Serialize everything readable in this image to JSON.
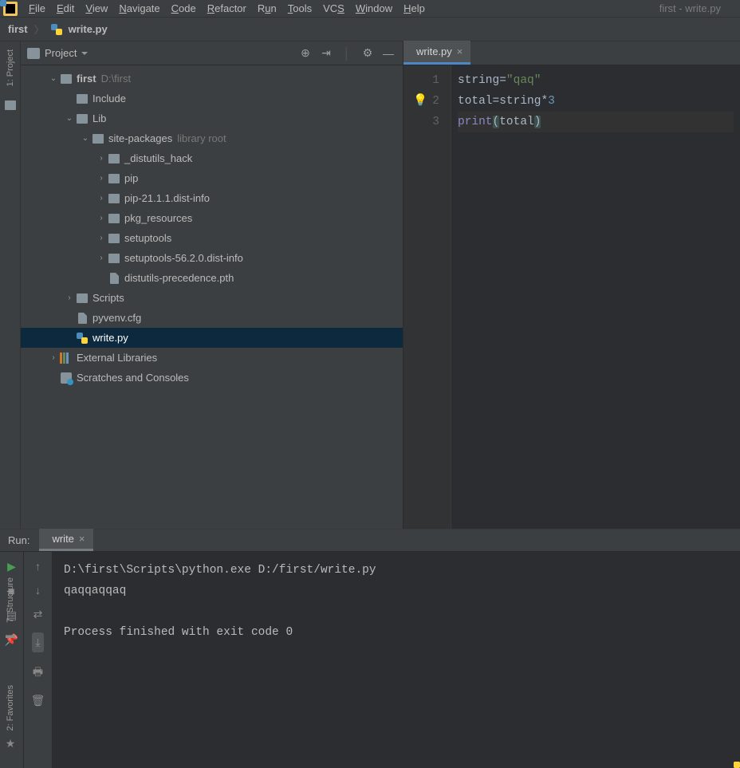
{
  "menubar": {
    "items": [
      {
        "label": "File",
        "u": "F",
        "rest": "ile"
      },
      {
        "label": "Edit",
        "u": "E",
        "rest": "dit"
      },
      {
        "label": "View",
        "u": "V",
        "rest": "iew"
      },
      {
        "label": "Navigate",
        "u": "N",
        "rest": "avigate"
      },
      {
        "label": "Code",
        "u": "C",
        "rest": "ode"
      },
      {
        "label": "Refactor",
        "u": "R",
        "rest": "efactor"
      },
      {
        "label": "Run",
        "u": "R",
        "rest": "un",
        "ualt": "u"
      },
      {
        "label": "Tools",
        "u": "T",
        "rest": "ools"
      },
      {
        "label": "VCS",
        "u": "VC",
        "rest": "",
        "ualt": "S"
      },
      {
        "label": "Window",
        "u": "W",
        "rest": "indow"
      },
      {
        "label": "Help",
        "u": "H",
        "rest": "elp"
      }
    ],
    "runconf": "first - write.py"
  },
  "breadcrumb": {
    "root": "first",
    "file": "write.py"
  },
  "project_header": {
    "title": "Project",
    "icons": [
      "target",
      "collapse",
      "divider",
      "gear",
      "minimize"
    ]
  },
  "tree": [
    {
      "depth": 0,
      "arrow": "down",
      "icon": "folder",
      "bold": true,
      "label": "first",
      "hint": "D:\\first"
    },
    {
      "depth": 1,
      "arrow": "none",
      "icon": "folder",
      "label": "Include"
    },
    {
      "depth": 1,
      "arrow": "down",
      "icon": "folder",
      "label": "Lib"
    },
    {
      "depth": 2,
      "arrow": "down",
      "icon": "folder",
      "label": "site-packages",
      "hint": "library root"
    },
    {
      "depth": 3,
      "arrow": "right",
      "icon": "folder",
      "label": "_distutils_hack"
    },
    {
      "depth": 3,
      "arrow": "right",
      "icon": "folder",
      "label": "pip"
    },
    {
      "depth": 3,
      "arrow": "right",
      "icon": "folder",
      "label": "pip-21.1.1.dist-info"
    },
    {
      "depth": 3,
      "arrow": "right",
      "icon": "folder",
      "label": "pkg_resources"
    },
    {
      "depth": 3,
      "arrow": "right",
      "icon": "folder",
      "label": "setuptools"
    },
    {
      "depth": 3,
      "arrow": "right",
      "icon": "folder",
      "label": "setuptools-56.2.0.dist-info"
    },
    {
      "depth": 3,
      "arrow": "none",
      "icon": "file",
      "label": "distutils-precedence.pth"
    },
    {
      "depth": 1,
      "arrow": "right",
      "icon": "folder",
      "label": "Scripts"
    },
    {
      "depth": 1,
      "arrow": "none",
      "icon": "file",
      "label": "pyvenv.cfg"
    },
    {
      "depth": 1,
      "arrow": "none",
      "icon": "py",
      "label": "write.py",
      "selected": true
    },
    {
      "depth": 0,
      "arrow": "right",
      "icon": "lib",
      "label": "External Libraries"
    },
    {
      "depth": 0,
      "arrow": "none",
      "icon": "scratch",
      "label": "Scratches and Consoles"
    }
  ],
  "editor": {
    "tab": "write.py",
    "lines": [
      {
        "n": "1",
        "tokens": [
          {
            "t": "string",
            "c": "id"
          },
          {
            "t": "=",
            "c": "op"
          },
          {
            "t": "\"qaq\"",
            "c": "str"
          }
        ]
      },
      {
        "n": "2",
        "bulb": true,
        "tokens": [
          {
            "t": "total",
            "c": "id"
          },
          {
            "t": "=",
            "c": "op"
          },
          {
            "t": "string",
            "c": "id"
          },
          {
            "t": "*",
            "c": "op"
          },
          {
            "t": "3",
            "c": "num"
          }
        ]
      },
      {
        "n": "3",
        "hl": true,
        "tokens": [
          {
            "t": "print",
            "c": "fn"
          },
          {
            "t": "(",
            "c": "par",
            "m": true
          },
          {
            "t": "total",
            "c": "id"
          },
          {
            "t": ")",
            "c": "par",
            "m": true
          }
        ]
      }
    ]
  },
  "run": {
    "label": "Run:",
    "tab": "write",
    "output": [
      "D:\\first\\Scripts\\python.exe D:/first/write.py",
      "qaqqaqqaq",
      "",
      "Process finished with exit code 0"
    ]
  },
  "left_tabs": {
    "project": "1: Project",
    "structure": "7: Structure",
    "favorites": "2: Favorites"
  }
}
